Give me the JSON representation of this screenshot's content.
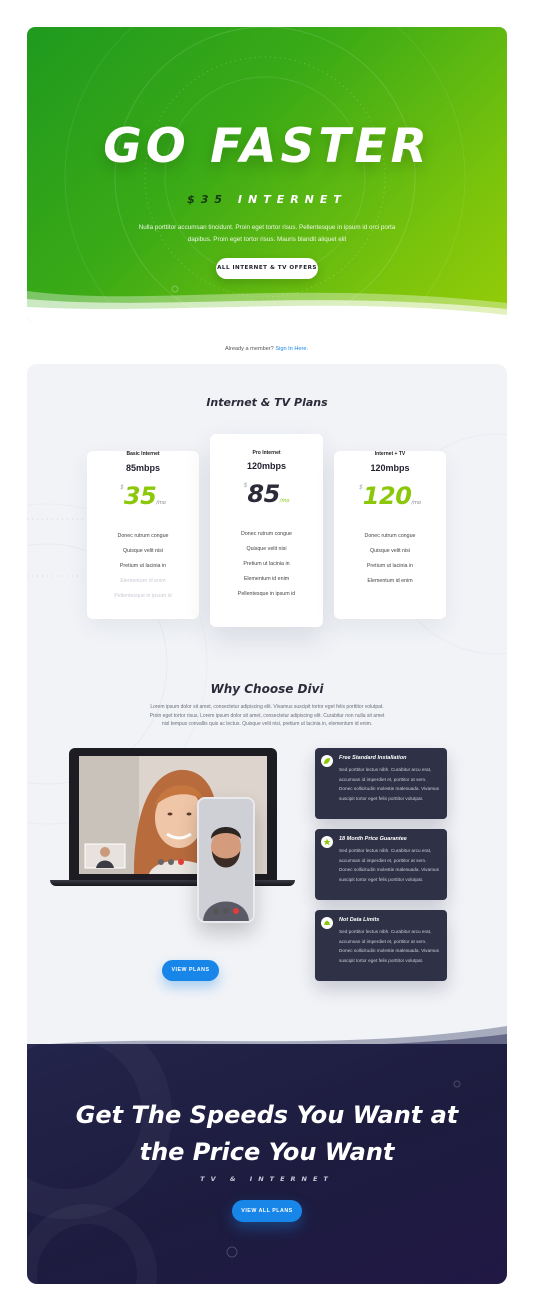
{
  "hero": {
    "title": "GO FASTER",
    "price": "$35",
    "price_suffix": "INTERNET",
    "text": "Nulla porttitor accumsan tincidunt. Proin eget tortor risus. Pellentesque in ipsum id orci porta dapibus. Proin eget tortor risus. Mauris blandit aliquet elit",
    "button_label": "ALL INTERNET & TV OFFERS"
  },
  "signin": {
    "text": "Already a member?",
    "link": "Sign In Here."
  },
  "plans": {
    "title": "Internet & TV Plans",
    "items": [
      {
        "name": "Basic Internet",
        "speed": "85mbps",
        "currency": "$",
        "amount": "35",
        "per": "/mo",
        "features": [
          "Donec rutrum congue",
          "Quisque velit nisi",
          "Pretium ut lacinia in",
          "Elementum id enim",
          "Pellentesque in ipsum id"
        ]
      },
      {
        "name": "Pro Internet",
        "speed": "120mbps",
        "currency": "$",
        "amount": "85",
        "per": "/mo",
        "features": [
          "Donec rutrum congue",
          "Quisque velit nisi",
          "Pretium ut lacinia in",
          "Elementum id enim",
          "Pellentesque in ipsum id"
        ]
      },
      {
        "name": "Internet + TV",
        "speed": "120mbps",
        "currency": "$",
        "amount": "120",
        "per": "/mo",
        "features": [
          "Donec rutrum congue",
          "Quisque velit nisi",
          "Pretium ut lacinia in",
          "Elementum id enim"
        ]
      }
    ]
  },
  "why": {
    "title": "Why Choose Divi",
    "text": "Lorem ipsum dolor sit amet, consectetur adipiscing elit. Vivamus suscipit tortor eget felis porttitor volutpat. Proin eget tortor risus. Lorem ipsum dolor sit amet, consectetur adipiscing elit. Curabitur non nulla sit amet nisl tempus convallis quis ac lectus. Quisque velit nisi, pretium ut lacinia in, elementum id enim.",
    "button_label": "VIEW PLANS",
    "features": [
      {
        "title": "Free Standard Installation",
        "icon": "leaf-icon",
        "text": "Sed porttitor lectus nibh. Curabitur arcu erat, accumsan id imperdiet et, porttitor at sem. Donec sollicitudin molestie malesuada. Vivamus suscipit tortor eget felis porttitor volutpat."
      },
      {
        "title": "18 Month Price Guarantee",
        "icon": "star-icon",
        "text": "Sed porttitor lectus nibh. Curabitur arcu erat, accumsan id imperdiet et, porttitor at sem. Donec sollicitudin molestie malesuada. Vivamus suscipit tortor eget felis porttitor volutpat."
      },
      {
        "title": "Not Data Limits",
        "icon": "cloud-icon",
        "text": "Sed porttitor lectus nibh. Curabitur arcu erat, accumsan id imperdiet et, porttitor at sem. Donec sollicitudin molestie malesuada. Vivamus suscipit tortor eget felis porttitor volutpat."
      }
    ]
  },
  "cta": {
    "title_line1": "Get The Speeds You Want at",
    "title_line2": "the Price You Want",
    "subtitle": "TV & INTERNET",
    "button_label": "VIEW ALL PLANS"
  },
  "colors": {
    "accent_green": "#8bc80a",
    "brand_blue": "#1786e8",
    "dark_navy": "#1e1d42",
    "feature_card": "#2f3246"
  }
}
